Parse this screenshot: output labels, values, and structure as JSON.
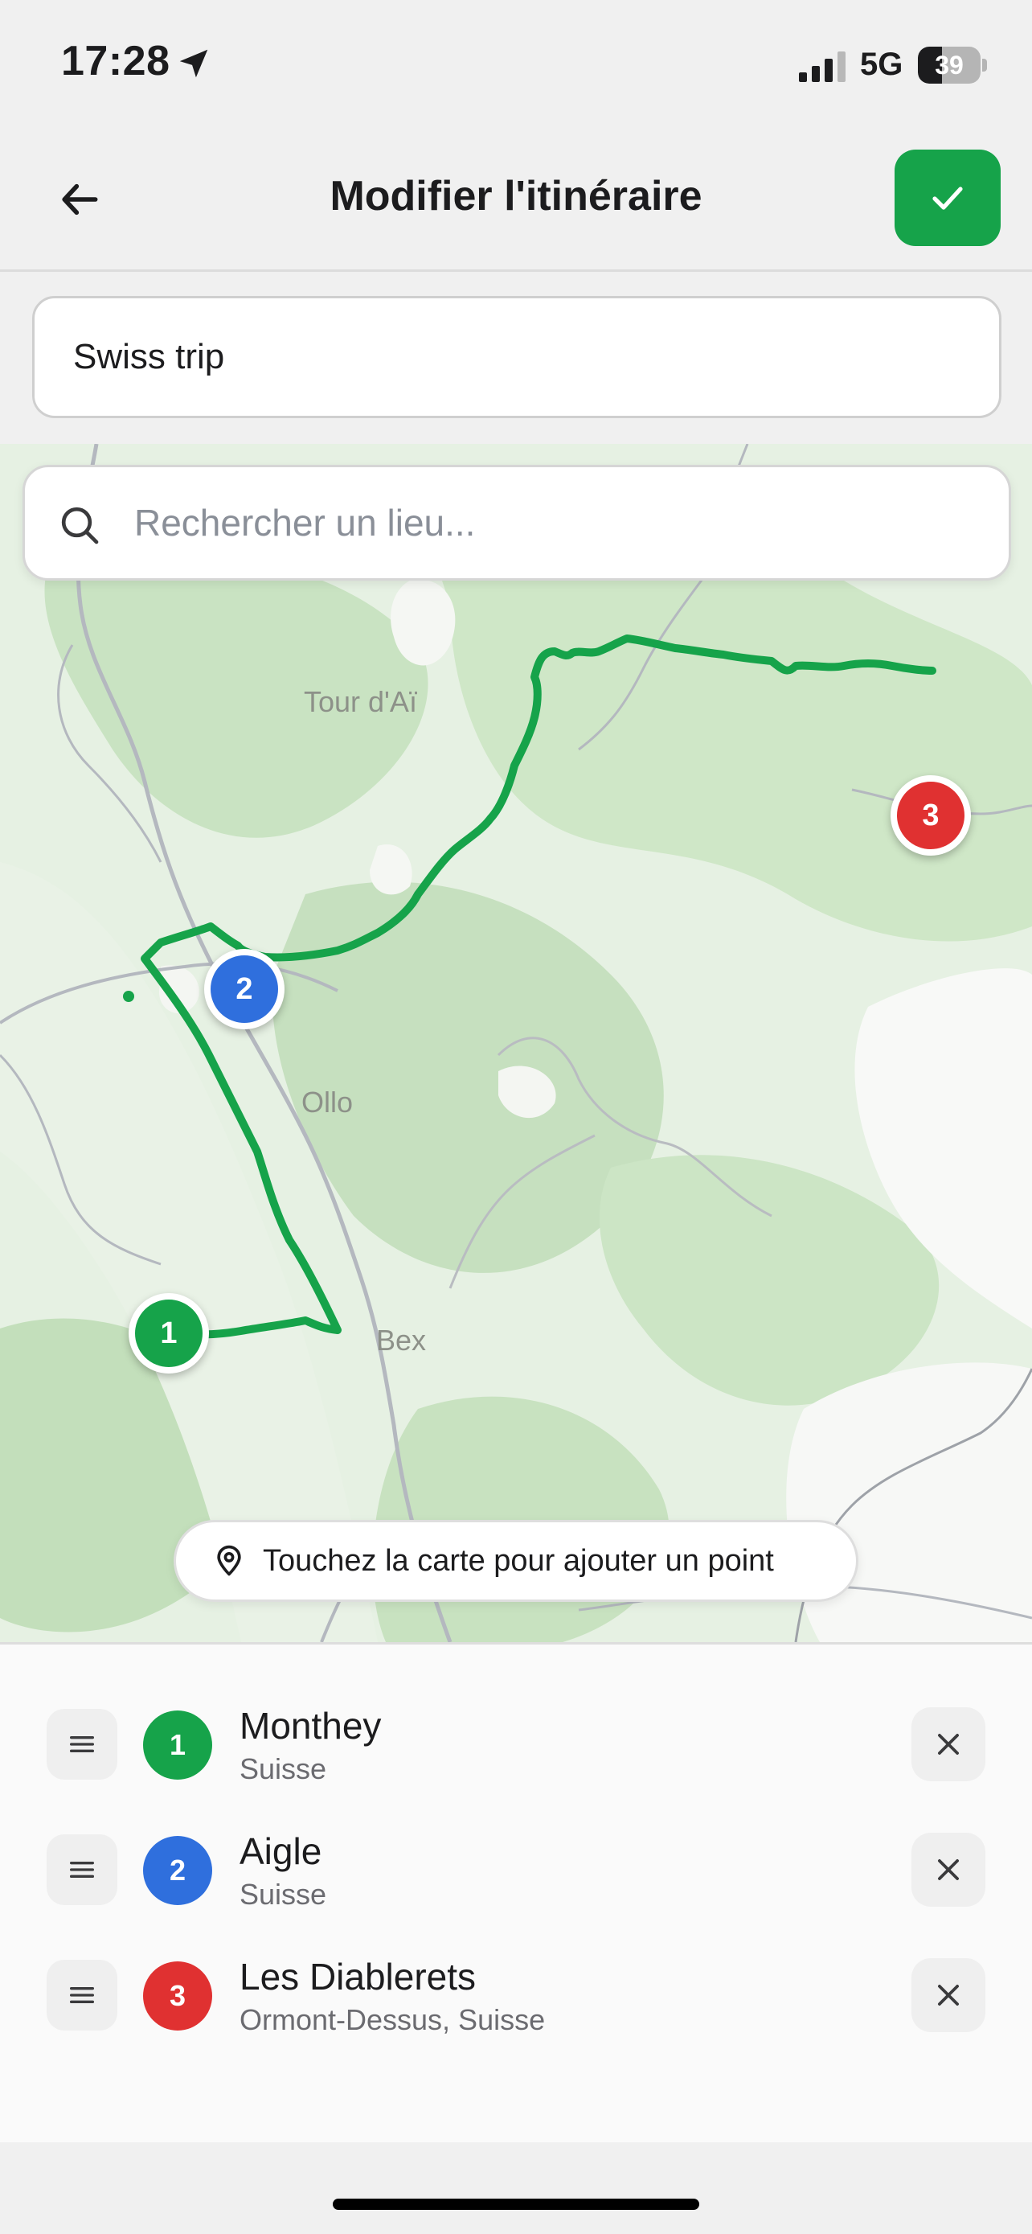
{
  "status_bar": {
    "time": "17:28",
    "network": "5G",
    "battery_percent": "39",
    "battery_level": 0.39
  },
  "header": {
    "title": "Modifier l'itinéraire",
    "back_icon": "arrow-left-icon",
    "confirm_icon": "checkmark-icon",
    "confirm_color": "#16a34a"
  },
  "trip_name": {
    "value": "Swiss trip"
  },
  "map": {
    "search_placeholder": "Rechercher un lieu...",
    "labels": {
      "tour_dai": "Tour d'Aï",
      "ollon": "Ollo",
      "bex": "Bex"
    },
    "route_color": "#16a34a",
    "hint_text": "Touchez la carte pour ajouter un point"
  },
  "waypoints": [
    {
      "number": "1",
      "name": "Monthey",
      "subtitle": "Suisse",
      "color": "#16a34a"
    },
    {
      "number": "2",
      "name": "Aigle",
      "subtitle": "Suisse",
      "color": "#2f6fdd"
    },
    {
      "number": "3",
      "name": "Les Diablerets",
      "subtitle": "Ormont-Dessus, Suisse",
      "color": "#e03131"
    }
  ]
}
